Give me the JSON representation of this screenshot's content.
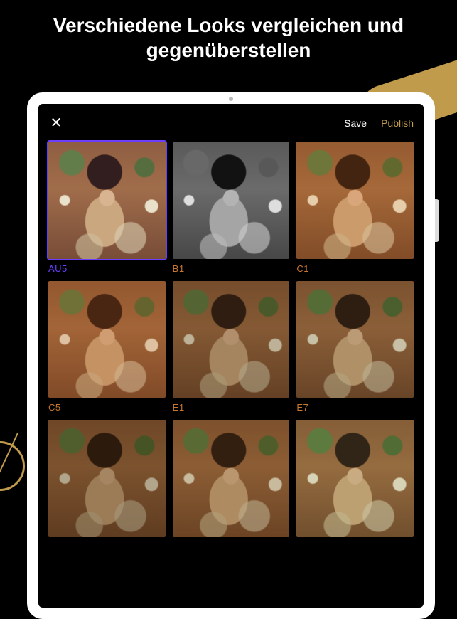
{
  "headline": "Verschiedene Looks vergleichen und gegenüberstellen",
  "toolbar": {
    "close_label": "✕",
    "save_label": "Save",
    "publish_label": "Publish"
  },
  "presets": [
    {
      "label": "AU5",
      "selected": true,
      "filter": "f-au5"
    },
    {
      "label": "B1",
      "selected": false,
      "filter": "f-b1"
    },
    {
      "label": "C1",
      "selected": false,
      "filter": "f-c1"
    },
    {
      "label": "C5",
      "selected": false,
      "filter": "f-c5"
    },
    {
      "label": "E1",
      "selected": false,
      "filter": "f-e1"
    },
    {
      "label": "E7",
      "selected": false,
      "filter": "f-e7"
    },
    {
      "label": "",
      "selected": false,
      "filter": "f-row3a"
    },
    {
      "label": "",
      "selected": false,
      "filter": "f-row3b"
    },
    {
      "label": "",
      "selected": false,
      "filter": "f-row3c"
    }
  ],
  "colors": {
    "accent_gold": "#C19B4C",
    "label_orange": "#C9772E",
    "label_purple": "#6B3EFF"
  }
}
